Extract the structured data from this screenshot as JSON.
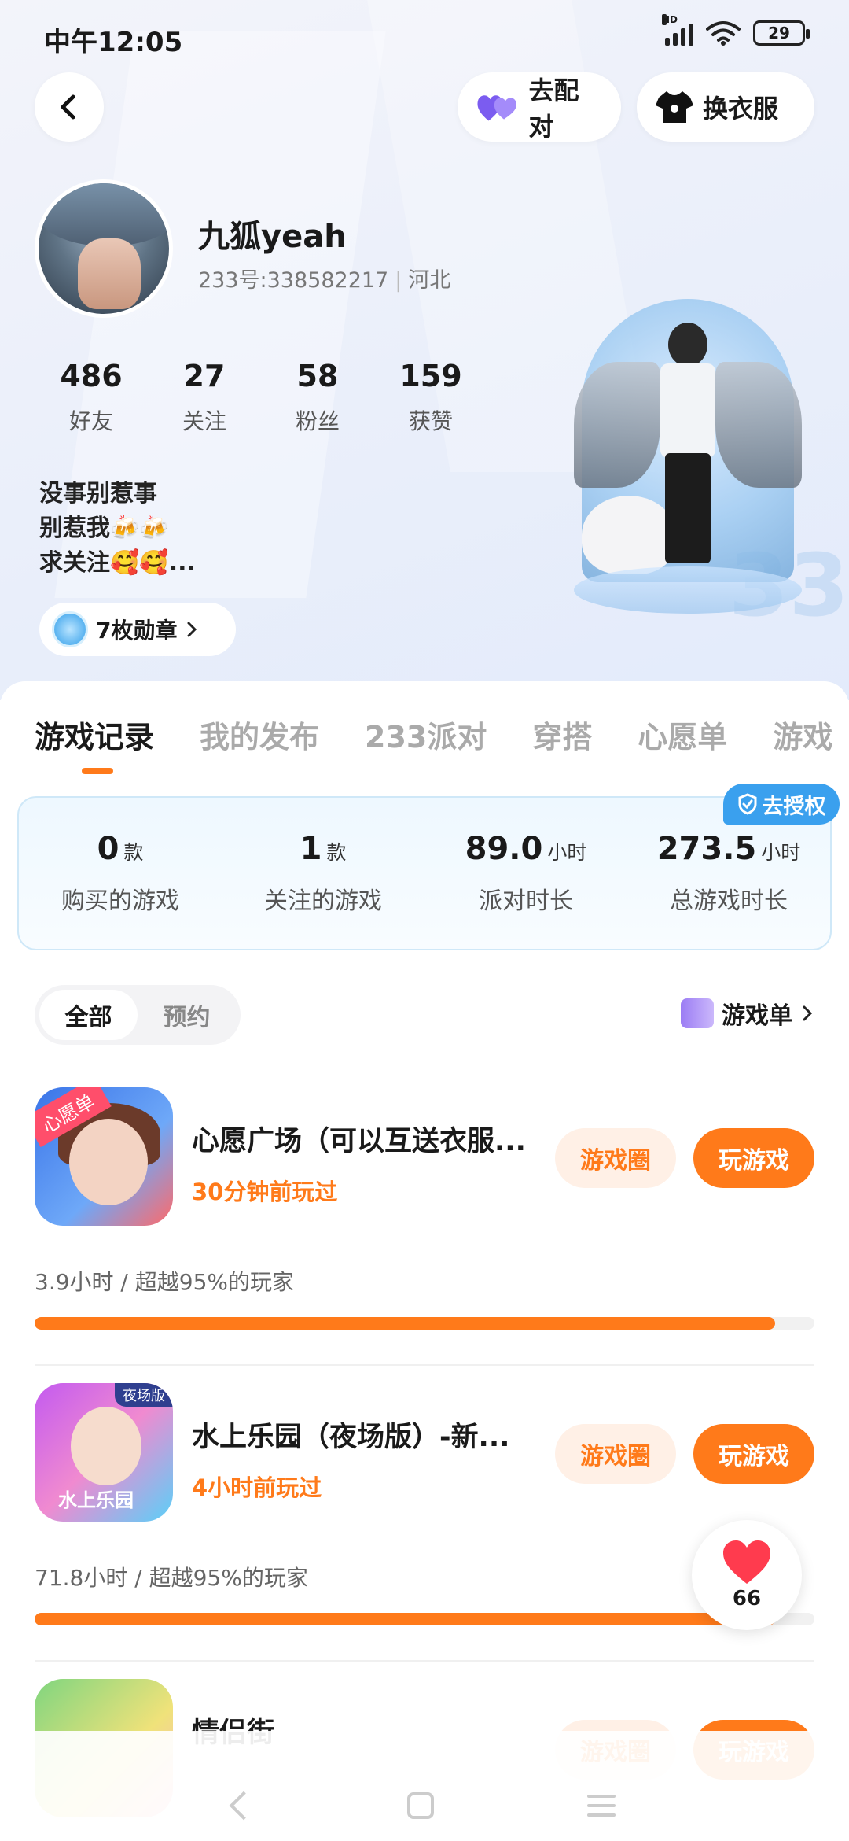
{
  "status": {
    "time": "中午12:05",
    "battery": "29",
    "network_badge": "HD"
  },
  "header": {
    "pair_label": "去配对",
    "outfit_label": "换衣服"
  },
  "profile": {
    "name": "九狐yeah",
    "id_text": "233号:338582217",
    "location": "河北",
    "stats": [
      {
        "value": "486",
        "label": "好友"
      },
      {
        "value": "27",
        "label": "关注"
      },
      {
        "value": "58",
        "label": "粉丝"
      },
      {
        "value": "159",
        "label": "获赞"
      }
    ],
    "bio": [
      "没事别惹事",
      "别惹我🍻🍻",
      "求关注🥰🥰..."
    ],
    "badge_label": "7枚勋章",
    "watermark": "33"
  },
  "tabs": [
    "游戏记录",
    "我的发布",
    "233派对",
    "穿搭",
    "心愿单",
    "游戏"
  ],
  "summary": {
    "auth_label": "去授权",
    "items": [
      {
        "value": "0",
        "unit": "款",
        "label": "购买的游戏"
      },
      {
        "value": "1",
        "unit": "款",
        "label": "关注的游戏"
      },
      {
        "value": "89.0",
        "unit": "小时",
        "label": "派对时长"
      },
      {
        "value": "273.5",
        "unit": "小时",
        "label": "总游戏时长"
      }
    ]
  },
  "filters": {
    "all": "全部",
    "reserve": "预约",
    "gamelist": "游戏单"
  },
  "games": [
    {
      "title": "心愿广场（可以互送衣服...",
      "played": "30分钟前玩过",
      "stat": "3.9小时 / 超越95%的玩家",
      "progress": 0.95,
      "icon_tag": "心愿单",
      "icon_corner": "",
      "circle_label": "游戏圈",
      "play_label": "玩游戏"
    },
    {
      "title": "水上乐园（夜场版）-新...",
      "played": "4小时前玩过",
      "stat": "71.8小时 / 超越95%的玩家",
      "progress": 0.95,
      "icon_tag": "水上乐园",
      "icon_corner": "夜场版",
      "circle_label": "游戏圈",
      "play_label": "玩游戏"
    },
    {
      "title": "情侣街",
      "played": "",
      "stat": "",
      "progress": 0,
      "icon_tag": "",
      "icon_corner": "",
      "circle_label": "游戏圈",
      "play_label": "玩游戏"
    }
  ],
  "likes": {
    "count": "66"
  },
  "colors": {
    "accent": "#ff7a1a",
    "auth": "#3aa0ee",
    "pair_heart": "#7b5cf0",
    "like_heart": "#ff3b4e"
  }
}
